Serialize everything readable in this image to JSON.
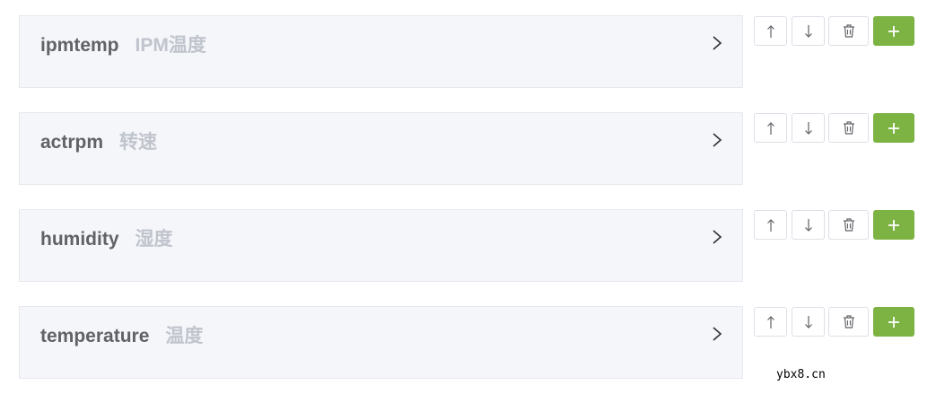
{
  "fields": [
    {
      "name": "ipmtemp",
      "label": "IPM温度"
    },
    {
      "name": "actrpm",
      "label": "转速"
    },
    {
      "name": "humidity",
      "label": "湿度"
    },
    {
      "name": "temperature",
      "label": "温度"
    }
  ],
  "icons": {
    "expand": "chevron-right-icon",
    "move_up": "arrow-up-icon",
    "move_down": "arrow-down-icon",
    "delete": "trash-icon",
    "add": "plus-icon"
  },
  "colors": {
    "add_button": "#7cb342",
    "panel_background": "#f5f6fa",
    "field_name": "#606266",
    "field_label": "#c0c4cc"
  },
  "watermark": "ybx8.cn"
}
